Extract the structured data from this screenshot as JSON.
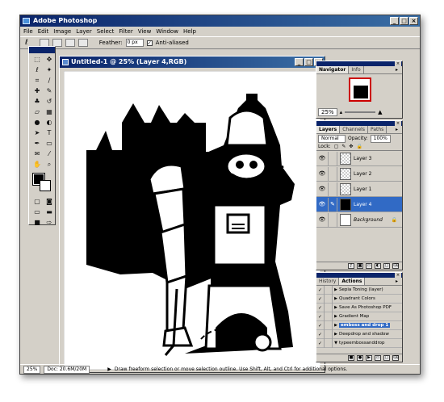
{
  "app": {
    "title": "Adobe Photoshop"
  },
  "menu": [
    "File",
    "Edit",
    "Image",
    "Layer",
    "Select",
    "Filter",
    "View",
    "Window",
    "Help"
  ],
  "options": {
    "feather_label": "Feather:",
    "feather_value": "0 px",
    "antialias_label": "Anti-aliased"
  },
  "document": {
    "title": "Untitled-1 @ 25% (Layer 4,RGB)"
  },
  "navigator": {
    "tabs": [
      "Navigator",
      "Info"
    ],
    "zoom": "25%"
  },
  "layers": {
    "tabs": [
      "Layers",
      "Channels",
      "Paths"
    ],
    "blend_mode": "Normal",
    "opacity_label": "Opacity:",
    "opacity_value": "100%",
    "lock_label": "Lock:",
    "items": [
      {
        "name": "Layer 3"
      },
      {
        "name": "Layer 2"
      },
      {
        "name": "Layer 1"
      },
      {
        "name": "Layer 4"
      },
      {
        "name": "Background"
      }
    ]
  },
  "actions": {
    "tabs": [
      "History",
      "Actions"
    ],
    "items": [
      "Sepia Toning (layer)",
      "Quadrant Colors",
      "Save As Photoshop PDF",
      "Gradient Map",
      "emboss and drop 1",
      "Deepdrop and shadow",
      "typeembossanddrop"
    ]
  },
  "status": {
    "zoom": "25%",
    "doc_size": "Doc: 20.6M/20M",
    "hint": "Draw freeform selection or move selection outline. Use Shift, Alt, and Ctrl for additional options."
  }
}
